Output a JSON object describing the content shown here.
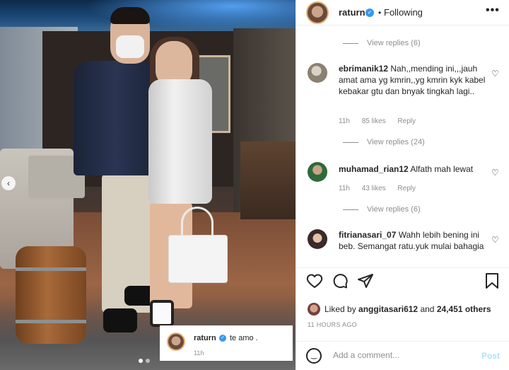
{
  "post": {
    "user": "raturn",
    "following_label": "Following",
    "more_icon": "more-horizontal-icon"
  },
  "comments": [
    {
      "type": "replies",
      "label": "View replies (6)"
    },
    {
      "type": "comment",
      "user": "ebrimanik12",
      "text": "Nah,,mending ini,,,jauh amat ama yg kmrin,,yg kmrin kyk kabel kebakar gtu dan bnyak tingkah lagi..",
      "time": "11h",
      "likes": "85 likes",
      "reply": "Reply"
    },
    {
      "type": "replies",
      "label": "View replies (24)"
    },
    {
      "type": "comment",
      "user": "muhamad_rian12",
      "text": "Alfath mah lewat",
      "time": "11h",
      "likes": "43 likes",
      "reply": "Reply"
    },
    {
      "type": "replies",
      "label": "View replies (6)"
    },
    {
      "type": "comment",
      "user": "fitrianasari_07",
      "text": "Wahh lebih bening ini beb. Semangat ratu.yuk mulai bahagia",
      "time": "",
      "likes": "",
      "reply": ""
    }
  ],
  "likes": {
    "prefix": "Liked by",
    "user": "anggitasari612",
    "connector": "and",
    "others": "24,451 others"
  },
  "time_ago": "11 HOURS AGO",
  "add_comment": {
    "placeholder": "Add a comment...",
    "post_label": "Post"
  },
  "caption": {
    "user": "raturn",
    "text": "te amo .",
    "time": "11h"
  },
  "colors": {
    "accent": "#3897f0",
    "post_disabled": "#b2dffc",
    "muted": "#8e8e8e"
  }
}
